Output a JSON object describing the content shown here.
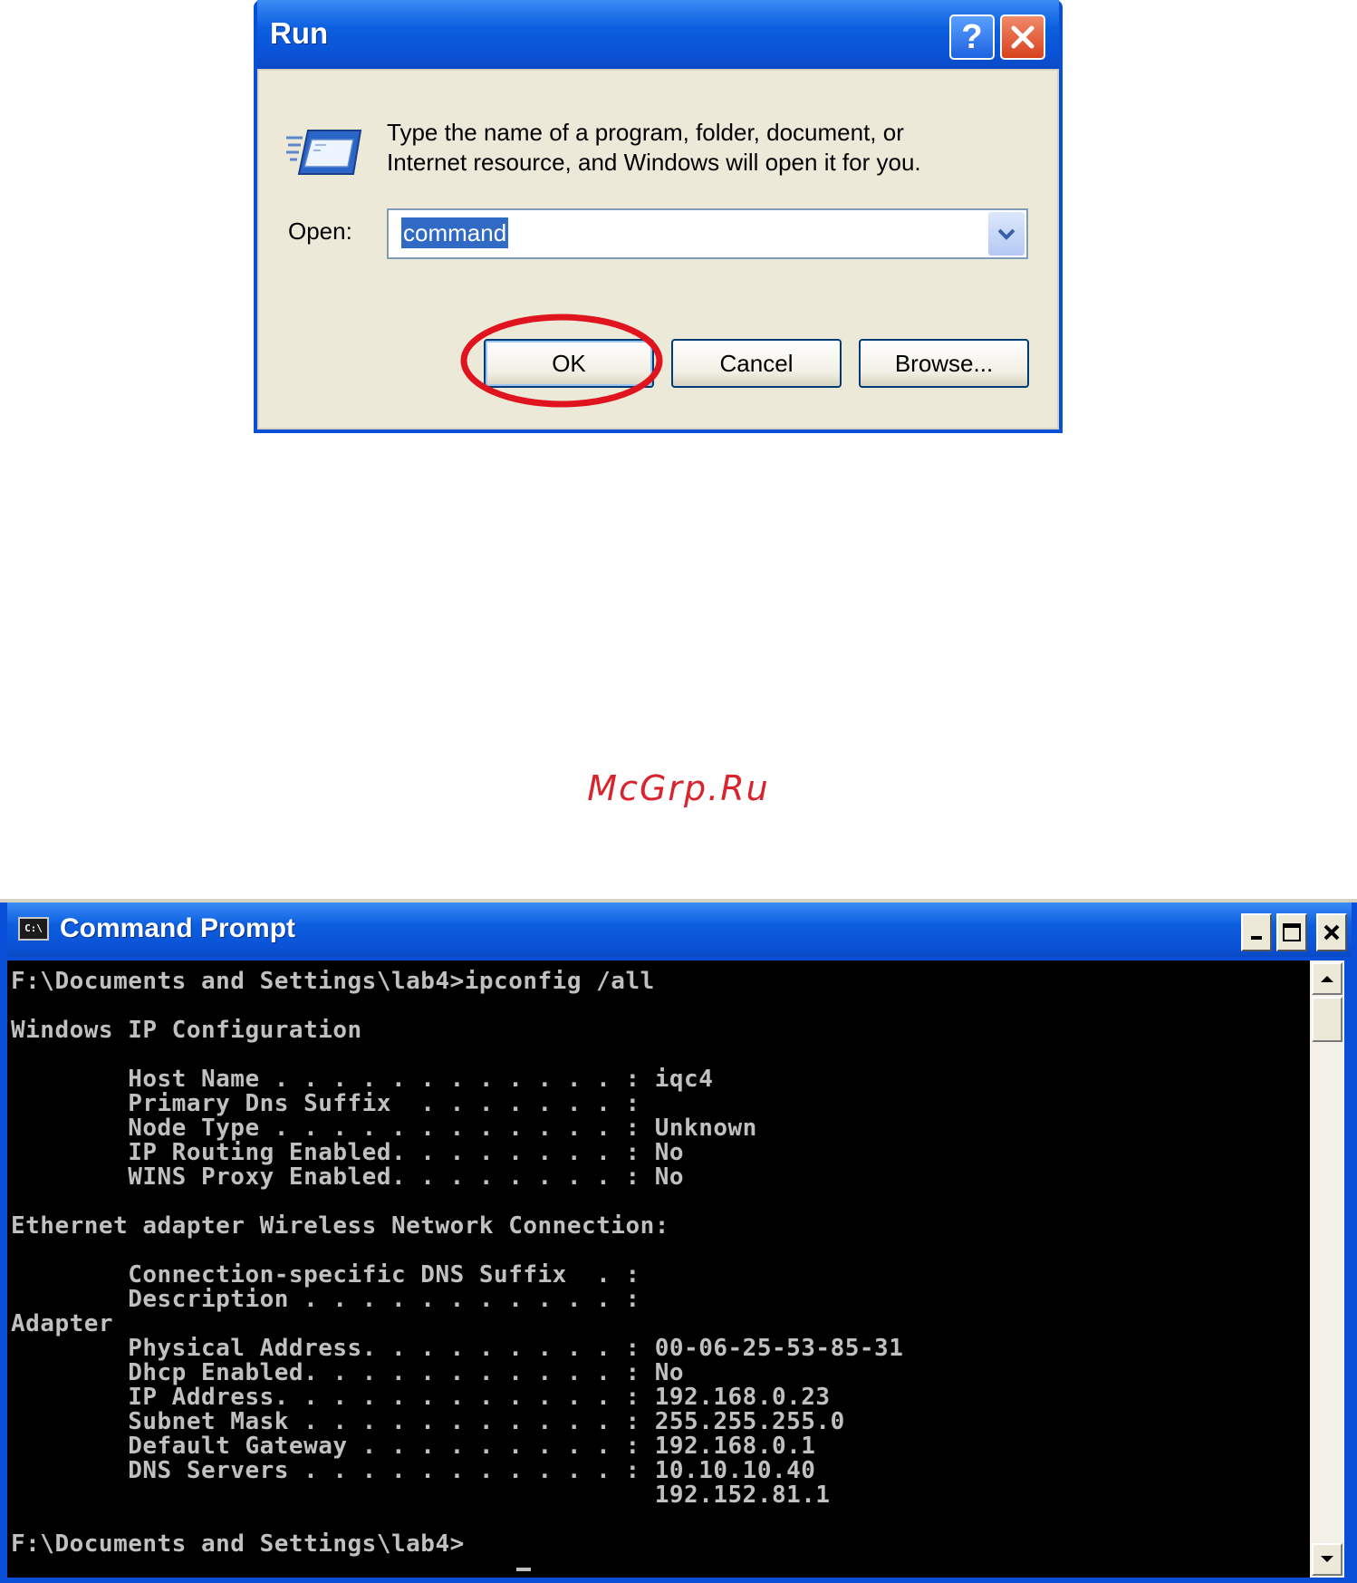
{
  "run_dialog": {
    "title": "Run",
    "message_line1": "Type the name of a program, folder, document, or",
    "message_line2": "Internet resource, and Windows will open it for you.",
    "open_label": "Open:",
    "open_value": "command",
    "buttons": {
      "ok": "OK",
      "cancel": "Cancel",
      "browse": "Browse..."
    },
    "icons": [
      "help-icon",
      "close-icon",
      "run-program-icon",
      "chevron-down-icon"
    ],
    "annotation_color": "#e0141e"
  },
  "watermark": "McGrp.Ru",
  "command_prompt": {
    "title": "Command Prompt",
    "title_icon_text": "C:\\",
    "lines": [
      "F:\\Documents and Settings\\lab4>ipconfig /all",
      "",
      "Windows IP Configuration",
      "",
      "        Host Name . . . . . . . . . . . . : iqc4",
      "        Primary Dns Suffix  . . . . . . . :",
      "        Node Type . . . . . . . . . . . . : Unknown",
      "        IP Routing Enabled. . . . . . . . : No",
      "        WINS Proxy Enabled. . . . . . . . : No",
      "",
      "Ethernet adapter Wireless Network Connection:",
      "",
      "        Connection-specific DNS Suffix  . :",
      "        Description . . . . . . . . . . . :",
      "Adapter",
      "        Physical Address. . . . . . . . . : 00-06-25-53-85-31",
      "        Dhcp Enabled. . . . . . . . . . . : No",
      "        IP Address. . . . . . . . . . . . : 192.168.0.23",
      "        Subnet Mask . . . . . . . . . . . : 255.255.255.0",
      "        Default Gateway . . . . . . . . . : 192.168.0.1",
      "        DNS Servers . . . . . . . . . . . : 10.10.10.40",
      "                                            192.152.81.1",
      "",
      "F:\\Documents and Settings\\lab4>"
    ],
    "icons": [
      "minimize-icon",
      "maximize-icon",
      "close-icon",
      "scroll-up-icon",
      "scroll-down-icon"
    ]
  }
}
